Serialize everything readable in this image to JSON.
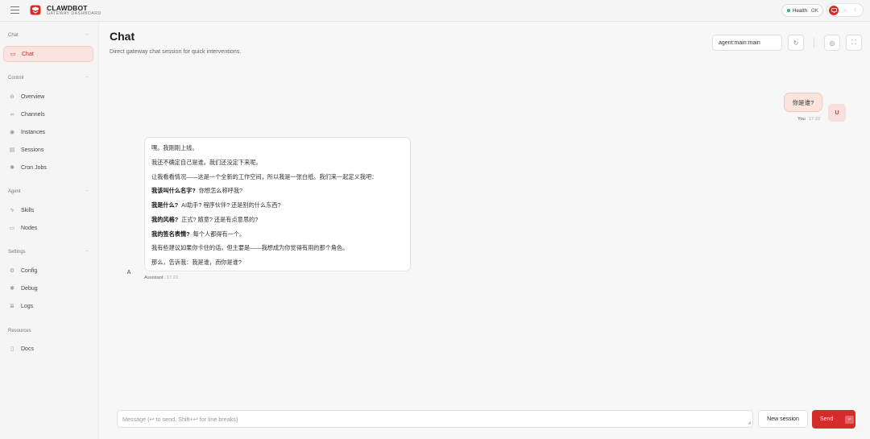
{
  "app": {
    "title": "CLAWDBOT",
    "subtitle": "GATEWAY DASHBOARD"
  },
  "health": {
    "label": "Health",
    "status": "OK"
  },
  "theme": {
    "options": [
      "monitor-icon",
      "sun-icon",
      "moon-icon"
    ],
    "active": "monitor-icon"
  },
  "colors": {
    "accent": "#d62b2b",
    "active_bg": "#fbe3e0",
    "user_bubble": "#fae4dc",
    "status_ok": "#2fb36b"
  },
  "sidebar": {
    "groups": [
      {
        "label": "Chat",
        "items": [
          {
            "label": "Chat",
            "icon": "chat-icon",
            "active": true
          }
        ]
      },
      {
        "label": "Control",
        "items": [
          {
            "label": "Overview",
            "icon": "bar-chart-icon"
          },
          {
            "label": "Channels",
            "icon": "link-icon"
          },
          {
            "label": "Instances",
            "icon": "radio-icon"
          },
          {
            "label": "Sessions",
            "icon": "file-icon"
          },
          {
            "label": "Cron Jobs",
            "icon": "loader-icon"
          }
        ]
      },
      {
        "label": "Agent",
        "items": [
          {
            "label": "Skills",
            "icon": "zap-icon"
          },
          {
            "label": "Nodes",
            "icon": "monitor-icon"
          }
        ]
      },
      {
        "label": "Settings",
        "items": [
          {
            "label": "Config",
            "icon": "settings-icon"
          },
          {
            "label": "Debug",
            "icon": "bug-icon"
          },
          {
            "label": "Logs",
            "icon": "scroll-icon"
          }
        ]
      },
      {
        "label": "Resources",
        "items": [
          {
            "label": "Docs",
            "icon": "book-icon"
          }
        ]
      }
    ]
  },
  "header": {
    "title": "Chat",
    "subtitle": "Direct gateway chat session for quick interventions.",
    "session_key": "agent:main:main"
  },
  "messages": [
    {
      "role": "user",
      "avatar": "U",
      "sender": "You",
      "time": "17:22",
      "text": "你是谁?"
    },
    {
      "role": "assistant",
      "avatar": "A",
      "sender": "Assistant",
      "time": "17:22",
      "lines": [
        {
          "text": "嘿。我刚刚上线。"
        },
        {
          "text": "我还不确定自己是谁。我们还没定下来呢。"
        },
        {
          "text": "让我看看情况——这是一个全新的工作空间，所以我是一张白纸。我们来一起定义我吧："
        },
        {
          "bold": "我该叫什么名字?",
          "text": "你想怎么称呼我?"
        },
        {
          "bold": "我是什么?",
          "text": "AI助手? 程序伙伴? 还是别的什么东西?"
        },
        {
          "bold": "我的风格?",
          "text": "正式? 随意? 还是有点意思的?"
        },
        {
          "bold": "我的签名表情?",
          "text": "每个人都得有一个。"
        },
        {
          "text": "我有些建议如果你卡住的话，但主要是——我想成为你觉得有用的那个角色。"
        },
        {
          "text": "那么，告诉我：我是谁，而你是谁?"
        }
      ]
    }
  ],
  "composer": {
    "placeholder": "Message (↩ to send, Shift+↩ for line breaks)",
    "new_session_label": "New session",
    "send_label": "Send",
    "send_kbd": "↵"
  }
}
